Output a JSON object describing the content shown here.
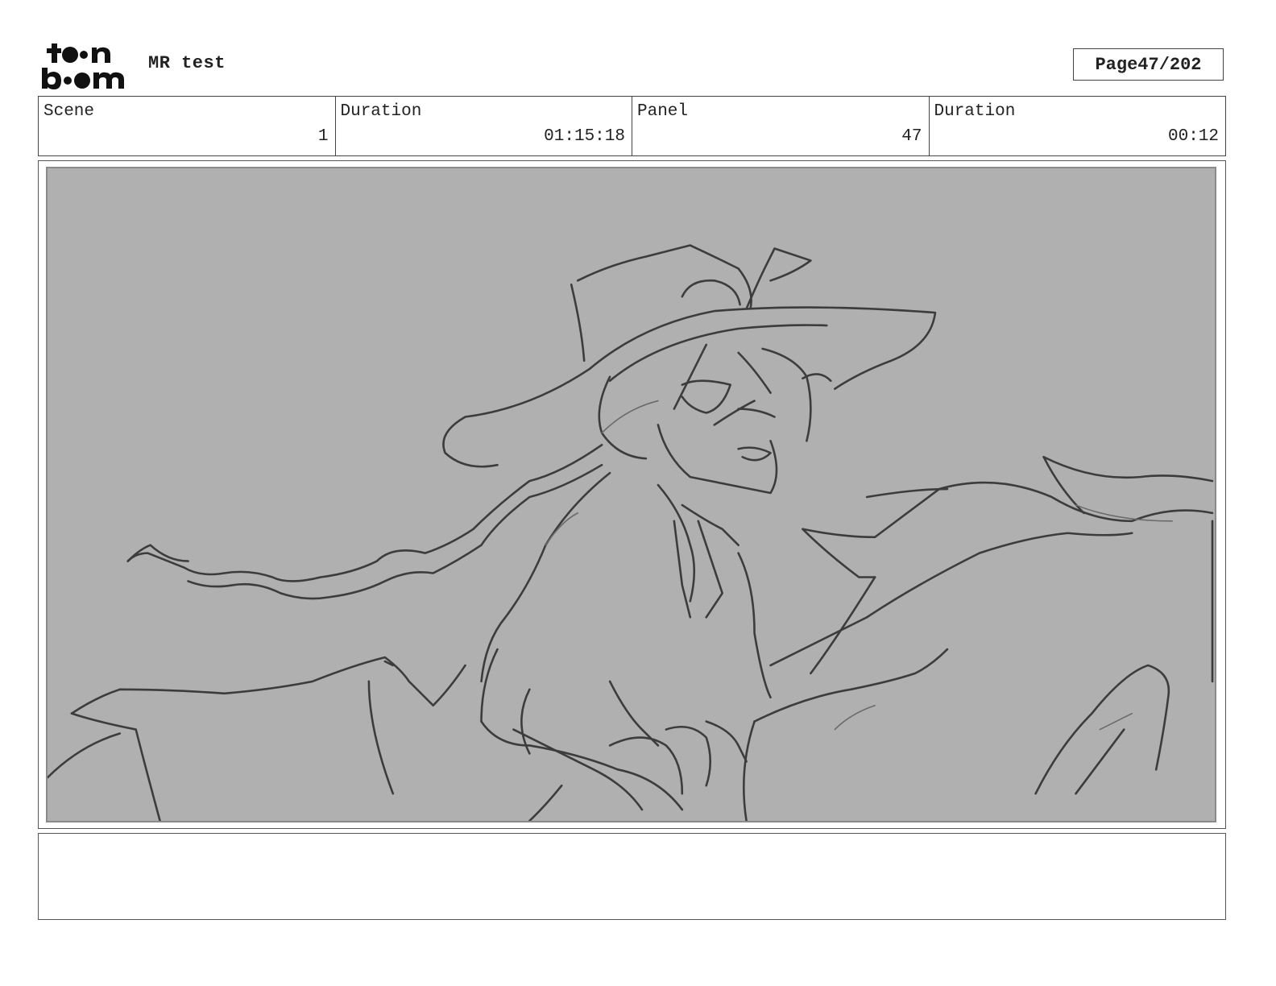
{
  "header": {
    "logo_text_line1": "toon",
    "logo_text_line2": "boom",
    "logo_icon": "toon-boom-logo",
    "project_title": "MR test",
    "page_label": "Page",
    "page_value": "47/202"
  },
  "info": {
    "scene_label": "Scene",
    "scene_value": "1",
    "scene_duration_label": "Duration",
    "scene_duration_value": "01:15:18",
    "panel_label": "Panel",
    "panel_value": "47",
    "panel_duration_label": "Duration",
    "panel_duration_value": "00:12"
  },
  "panel": {
    "image": "sketch-witch-reclining",
    "background_color": "#b0b0b0"
  },
  "notes": {
    "text": ""
  }
}
